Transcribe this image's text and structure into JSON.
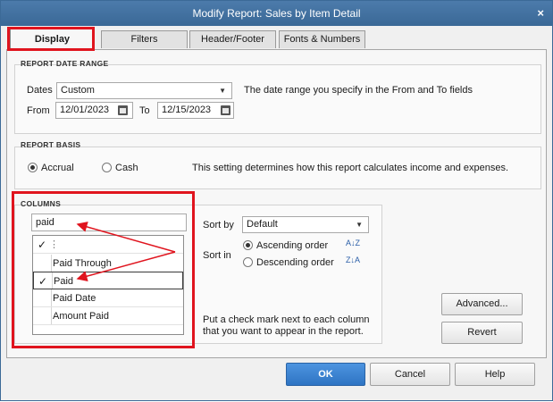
{
  "window": {
    "title": "Modify Report: Sales by Item Detail",
    "close_symbol": "×"
  },
  "tabs": [
    {
      "label": "Display",
      "active": true
    },
    {
      "label": "Filters",
      "active": false
    },
    {
      "label": "Header/Footer",
      "active": false
    },
    {
      "label": "Fonts & Numbers",
      "active": false
    }
  ],
  "date_range": {
    "title": "REPORT DATE RANGE",
    "dates_label": "Dates",
    "dates_value": "Custom",
    "hint": "The date range you specify in the From and To fields",
    "from_label": "From",
    "from_value": "12/01/2023",
    "to_label": "To",
    "to_value": "12/15/2023"
  },
  "report_basis": {
    "title": "REPORT BASIS",
    "accrual_label": "Accrual",
    "cash_label": "Cash",
    "selected": "Accrual",
    "hint": "This setting determines how this report calculates income and expenses."
  },
  "columns": {
    "title": "COLUMNS",
    "search_value": "paid",
    "header_check": "✓",
    "header_dots": "⋮",
    "items": [
      {
        "label": "Paid Through",
        "checked": false
      },
      {
        "label": "Paid",
        "checked": true
      },
      {
        "label": "Paid Date",
        "checked": false
      },
      {
        "label": "Amount Paid",
        "checked": false
      }
    ],
    "sort_by_label": "Sort by",
    "sort_by_value": "Default",
    "sort_in_label": "Sort in",
    "ascending_label": "Ascending order",
    "descending_label": "Descending order",
    "sort_selected": "Ascending order",
    "hint": "Put a check mark next to each column that you want to appear in the report."
  },
  "buttons": {
    "advanced": "Advanced...",
    "revert": "Revert",
    "ok": "OK",
    "cancel": "Cancel",
    "help": "Help"
  },
  "colors": {
    "annotation": "#e0141e",
    "titlebar": "#3a6896",
    "primary": "#2e74c3"
  }
}
